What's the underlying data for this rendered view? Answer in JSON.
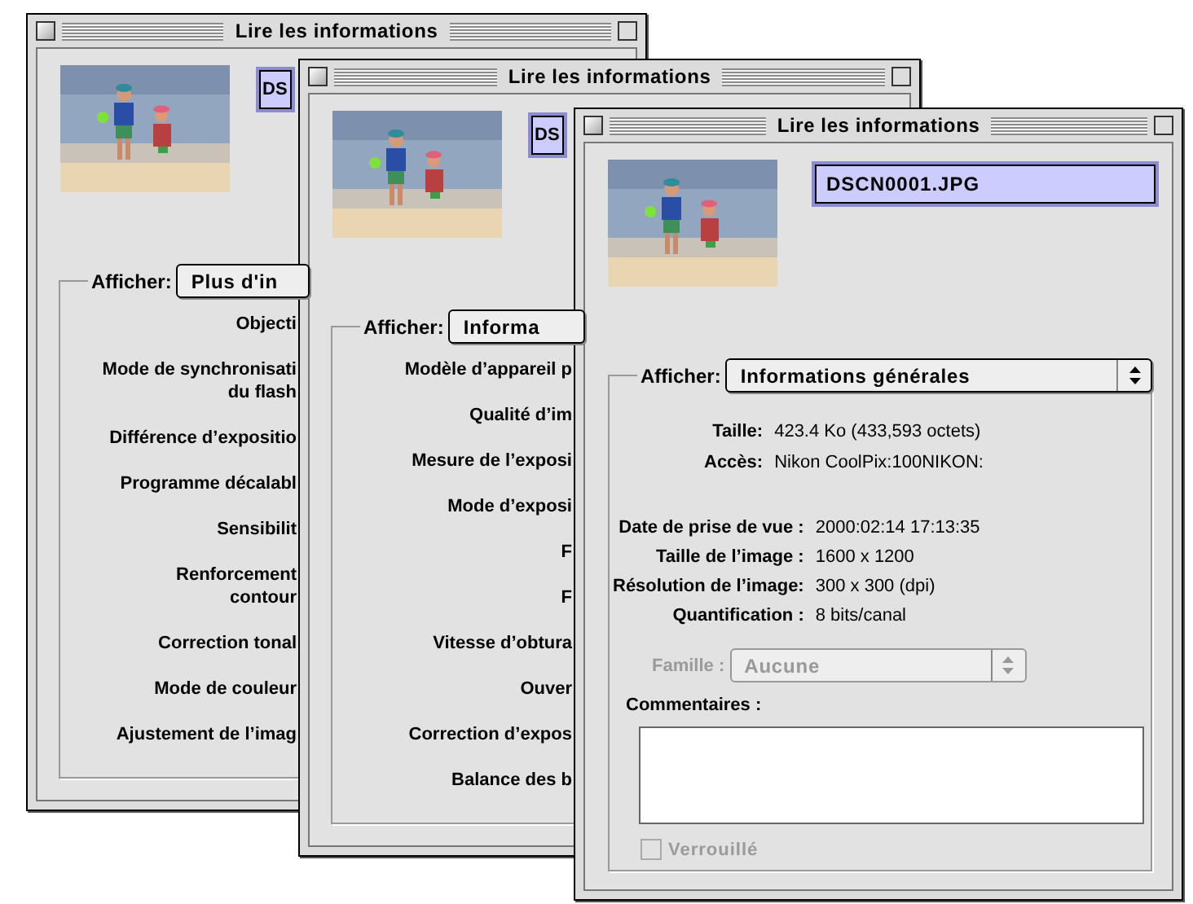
{
  "windows": [
    {
      "title": "Lire les informations",
      "filename": {
        "value": "DS",
        "highlighted": true
      },
      "display": {
        "label": "Afficher:",
        "value": "Plus d'in"
      },
      "rows": [
        {
          "label": "Objecti"
        },
        {
          "label": "Mode de synchronisati\ndu flash"
        },
        {
          "label": "Différence d’expositio"
        },
        {
          "label": "Programme décalabl"
        },
        {
          "label": "Sensibilit"
        },
        {
          "label": "Renforcement\ncontour"
        },
        {
          "label": "Correction tonal"
        },
        {
          "label": "Mode de couleur"
        },
        {
          "label": "Ajustement de l’imag"
        }
      ]
    },
    {
      "title": "Lire les informations",
      "filename": {
        "value": "DS",
        "highlighted": true
      },
      "display": {
        "label": "Afficher:",
        "value": "Informa"
      },
      "rows": [
        {
          "label": "Modèle d’appareil p"
        },
        {
          "label": "Qualité d’im"
        },
        {
          "label": "Mesure de l’exposi"
        },
        {
          "label": "Mode d’exposi"
        },
        {
          "label": "F"
        },
        {
          "label": "F"
        },
        {
          "label": "Vitesse d’obtura"
        },
        {
          "label": "Ouver"
        },
        {
          "label": "Correction d’expos"
        },
        {
          "label": "Balance des b"
        }
      ]
    },
    {
      "title": "Lire les informations",
      "filename": {
        "value": "DSCN0001.JPG",
        "highlighted": true
      },
      "display": {
        "label": "Afficher:",
        "value": "Informations générales"
      },
      "info": [
        {
          "label": "Taille:",
          "value": "423.4 Ko (433,593 octets)"
        },
        {
          "label": "Accès:",
          "value": "Nikon CoolPix:100NIKON:"
        }
      ],
      "details": [
        {
          "label": "Date de prise de vue :",
          "value": "2000:02:14 17:13:35"
        },
        {
          "label": "Taille de l’image :",
          "value": "1600 x 1200"
        },
        {
          "label": "Résolution de l’image:",
          "value": "300 x 300 (dpi)"
        },
        {
          "label": "Quantification :",
          "value": "8 bits/canal"
        }
      ],
      "family": {
        "label": "Famille :",
        "value": "Aucune",
        "disabled": true
      },
      "comments": {
        "label": "Commentaires :"
      },
      "locked": {
        "label": "Verrouillé",
        "checked": false,
        "disabled": true
      }
    }
  ]
}
